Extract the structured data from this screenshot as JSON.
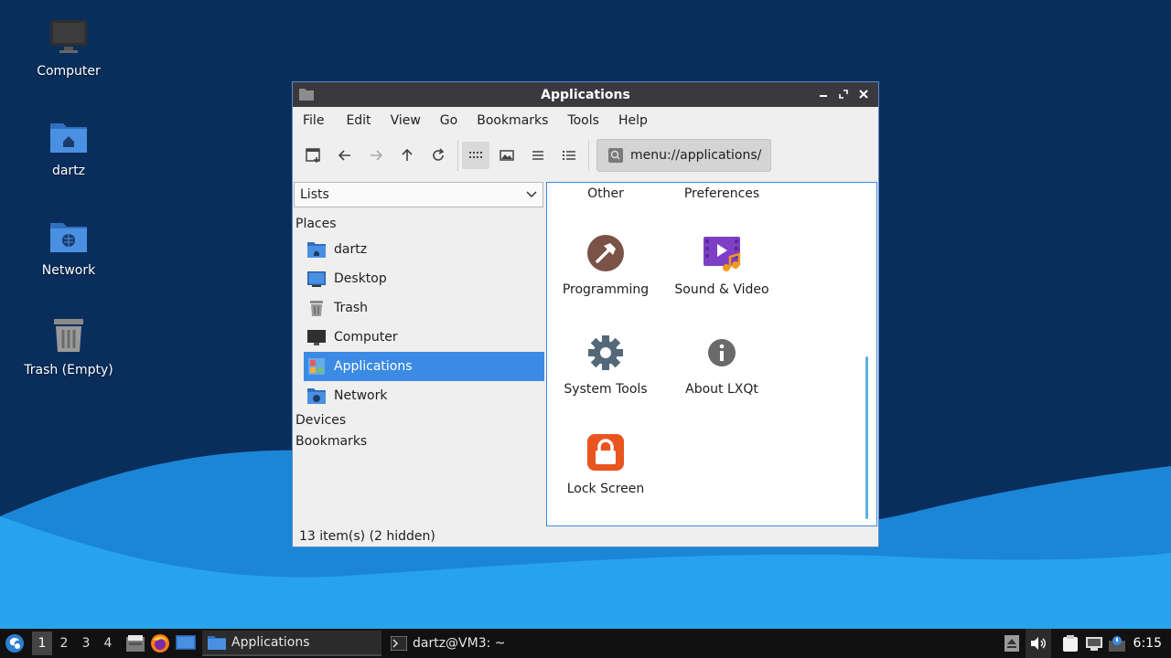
{
  "desktop": {
    "icons": [
      {
        "label": "Computer",
        "icon": "computer-icon"
      },
      {
        "label": "dartz",
        "icon": "home-folder-icon"
      },
      {
        "label": "Network",
        "icon": "network-folder-icon"
      },
      {
        "label": "Trash (Empty)",
        "icon": "trash-icon"
      }
    ]
  },
  "window": {
    "title": "Applications",
    "menu": [
      "File",
      "Edit",
      "View",
      "Go",
      "Bookmarks",
      "Tools",
      "Help"
    ],
    "location": "menu://applications/",
    "sidebar": {
      "mode": "Lists",
      "places_label": "Places",
      "places": [
        {
          "label": "dartz",
          "icon": "home-folder-icon"
        },
        {
          "label": "Desktop",
          "icon": "desktop-icon"
        },
        {
          "label": "Trash",
          "icon": "trash-icon"
        },
        {
          "label": "Computer",
          "icon": "computer-icon"
        },
        {
          "label": "Applications",
          "icon": "applications-icon",
          "selected": true
        },
        {
          "label": "Network",
          "icon": "network-folder-icon"
        }
      ],
      "devices_label": "Devices",
      "bookmarks_label": "Bookmarks"
    },
    "items": [
      {
        "label": "Other",
        "icon": "other-icon"
      },
      {
        "label": "Preferences",
        "icon": "preferences-icon"
      },
      {
        "label": "Programming",
        "icon": "hammer-icon"
      },
      {
        "label": "Sound & Video",
        "icon": "multimedia-icon"
      },
      {
        "label": "System Tools",
        "icon": "gear-icon"
      },
      {
        "label": "About LXQt",
        "icon": "info-icon"
      },
      {
        "label": "Lock Screen",
        "icon": "lock-icon"
      }
    ],
    "status": "13 item(s) (2 hidden)"
  },
  "taskbar": {
    "desktops": [
      "1",
      "2",
      "3",
      "4"
    ],
    "active_desktop": "1",
    "tasks": [
      {
        "label": "Applications",
        "icon": "folder-icon",
        "active": true
      },
      {
        "label": "dartz@VM3: ~",
        "icon": "terminal-icon"
      }
    ],
    "clock": "6:15"
  },
  "colors": {
    "accent": "#3b8ae4",
    "titlebar": "#3a3a3e",
    "desktop": "#0b2f5e"
  }
}
